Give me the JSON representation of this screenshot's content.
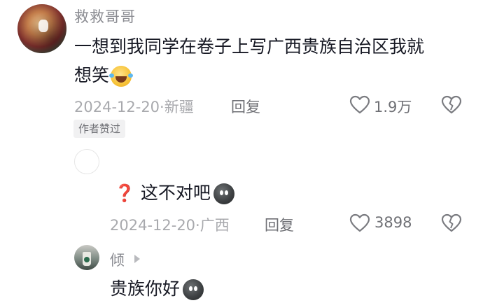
{
  "comments": [
    {
      "username": "救救哥哥",
      "text_line1": "一想到我同学在卷子上写广西贵族自治区我就",
      "text_line2": "想笑",
      "emoji_icon": "laughing-with-tears-emoji-icon",
      "date_location": "2024-12-20·新疆",
      "reply_label": "回复",
      "like_count": "1.9万",
      "badge": "作者赞过"
    },
    {
      "username": "",
      "emoji_prefix_icon": "red-question-mark-icon",
      "prefix_symbol": "❓",
      "text": "这不对吧",
      "emoji_icon": "dark-emoji-icon",
      "date_location": "2024-12-20·广西",
      "reply_label": "回复",
      "like_count": "3898"
    },
    {
      "username": "倾",
      "text": "贵族你好",
      "emoji_icon": "dark-emoji-icon"
    }
  ],
  "colors": {
    "text": "#161823",
    "secondary": "#a8a9ad",
    "username": "#8a8b91",
    "badge_bg": "#f1f1f2",
    "question_mark": "#e0312b"
  }
}
